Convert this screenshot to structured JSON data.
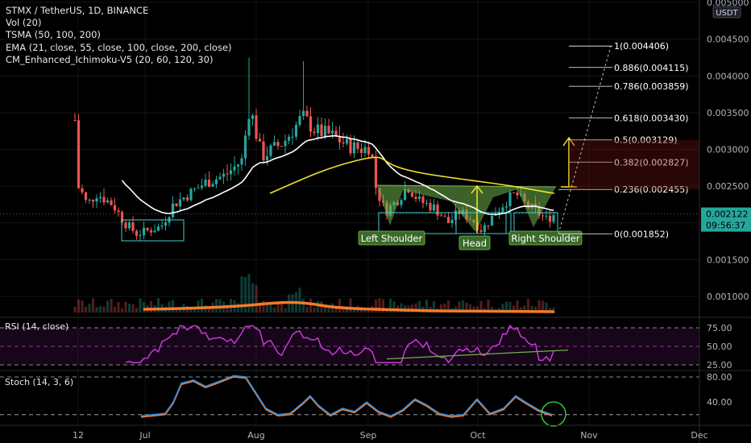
{
  "header": {
    "lines": [
      "STMX / TetherUS, 1D, BINANCE",
      "Vol (20)",
      "TSMA (50, 100, 200)",
      "EMA (21, close, 55, close, 100, close, 200, close)",
      "CM_Enhanced_Ichimoku-V5 (20, 60, 120, 30)"
    ],
    "currency_badge": "USDT"
  },
  "price_axis": {
    "ticks": [
      "0.005000",
      "0.004500",
      "0.004000",
      "0.003500",
      "0.003000",
      "0.002500",
      "0.002000",
      "0.001500",
      "0.001000"
    ],
    "last_price": "0.002122",
    "countdown": "09:56:37"
  },
  "x_axis": {
    "ticks": [
      "12",
      "Jul",
      "Aug",
      "Sep",
      "Oct",
      "Nov",
      "Dec"
    ]
  },
  "fib_levels": [
    {
      "label": "1(0.004406)",
      "value": 0.004406
    },
    {
      "label": "0.886(0.004115)",
      "value": 0.004115
    },
    {
      "label": "0.786(0.003859)",
      "value": 0.003859
    },
    {
      "label": "0.618(0.003430)",
      "value": 0.00343
    },
    {
      "label": "0.5(0.003129)",
      "value": 0.003129
    },
    {
      "label": "0.382(0.002827)",
      "value": 0.002827
    },
    {
      "label": "0.236(0.002455)",
      "value": 0.002455
    },
    {
      "label": "0(0.001852)",
      "value": 0.001852
    }
  ],
  "annotations": {
    "left_shoulder": "Left Shoulder",
    "head": "Head",
    "right_shoulder": "Right Shoulder"
  },
  "rsi": {
    "label": "RSI (14, close)",
    "ticks": [
      "75.00",
      "50.00",
      "25.00"
    ]
  },
  "stoch": {
    "label": "Stoch (14, 3, 6)",
    "ticks": [
      "80.00",
      "40.00"
    ]
  },
  "colors": {
    "up": "#26a69a",
    "down": "#ef5350",
    "ema_white": "#ffffff",
    "ema_yellow": "#f2e22a",
    "rsi_line": "#c83bd6",
    "stoch_k": "#2f8fe8",
    "stoch_d": "#f27b2c",
    "pattern_fill": "#6fb24a",
    "box": "#3fd0d0"
  },
  "chart_data": {
    "type": "candlestick",
    "title": "STMX / TetherUS, 1D, BINANCE",
    "ylim": [
      0.0005,
      0.005
    ],
    "key_points": [
      {
        "x": "Jun 12",
        "y": 0.0034
      },
      {
        "x": "Jun 27",
        "y": 0.00185
      },
      {
        "x": "Jul 30",
        "y": 0.0042
      },
      {
        "x": "Aug 18",
        "y": 0.0033
      },
      {
        "x": "Sep 1",
        "y": 0.0031
      },
      {
        "x": "Sep 4",
        "y": 0.00195
      },
      {
        "x": "Sep 27",
        "y": 0.00185
      },
      {
        "x": "Oct 12",
        "y": 0.00265
      },
      {
        "x": "Oct 21",
        "y": 0.002122
      }
    ],
    "last_close": 0.002122,
    "fib_retracement": [
      {
        "ratio": 1,
        "value": 0.004406
      },
      {
        "ratio": 0.886,
        "value": 0.004115
      },
      {
        "ratio": 0.786,
        "value": 0.003859
      },
      {
        "ratio": 0.618,
        "value": 0.00343
      },
      {
        "ratio": 0.5,
        "value": 0.003129
      },
      {
        "ratio": 0.382,
        "value": 0.002827
      },
      {
        "ratio": 0.236,
        "value": 0.002455
      },
      {
        "ratio": 0,
        "value": 0.001852
      }
    ],
    "pattern": [
      "Left Shoulder",
      "Head",
      "Right Shoulder"
    ],
    "rsi_range": [
      25,
      75
    ],
    "stoch_range": [
      20,
      80
    ]
  }
}
